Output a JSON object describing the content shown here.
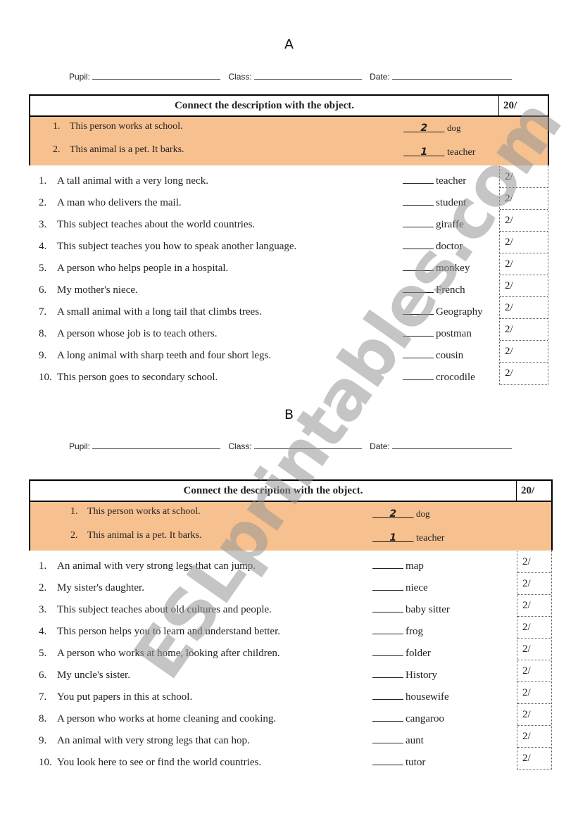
{
  "watermark": "ESLprintables.com",
  "sections": [
    {
      "title": "A",
      "info": {
        "pupil_label": "Pupil:",
        "class_label": "Class:",
        "date_label": "Date:"
      },
      "instruction": "Connect the description with the object.",
      "total_score": "20/",
      "examples": [
        {
          "num": "1.",
          "text": "This person works at school.",
          "answer": "2",
          "option": "dog"
        },
        {
          "num": "2.",
          "text": "This animal is a pet. It barks.",
          "answer": "1",
          "option": "teacher"
        }
      ],
      "items": [
        {
          "num": "1.",
          "text": "A tall animal with a very long neck.",
          "option": "teacher",
          "score": "2/"
        },
        {
          "num": "2.",
          "text": "A man who delivers the mail.",
          "option": "student",
          "score": "2/"
        },
        {
          "num": "3.",
          "text": "This subject teaches about the world countries.",
          "option": "giraffe",
          "score": "2/"
        },
        {
          "num": "4.",
          "text": "This subject teaches you how to speak another language.",
          "option": "doctor",
          "score": "2/"
        },
        {
          "num": "5.",
          "text": "A person who helps people in a hospital.",
          "option": "monkey",
          "score": "2/"
        },
        {
          "num": "6.",
          "text": "My mother's niece.",
          "option": "French",
          "score": "2/"
        },
        {
          "num": "7.",
          "text": "A small animal with a long tail that climbs trees.",
          "option": "Geography",
          "score": "2/"
        },
        {
          "num": "8.",
          "text": "A person whose job is to teach others.",
          "option": "postman",
          "score": "2/"
        },
        {
          "num": "9.",
          "text": "A long animal with sharp teeth and four short legs.",
          "option": "cousin",
          "score": "2/"
        },
        {
          "num": "10.",
          "text": "This person goes to secondary school.",
          "option": "crocodile",
          "score": "2/"
        }
      ]
    },
    {
      "title": "B",
      "info": {
        "pupil_label": "Pupil:",
        "class_label": "Class:",
        "date_label": "Date:"
      },
      "instruction": "Connect the description with the object.",
      "total_score": "20/",
      "examples": [
        {
          "num": "1.",
          "text": "This person works at school.",
          "answer": "2",
          "option": "dog"
        },
        {
          "num": "2.",
          "text": "This animal is a pet. It barks.",
          "answer": "1",
          "option": "teacher"
        }
      ],
      "items": [
        {
          "num": "1.",
          "text": "An animal with very strong legs that can jump.",
          "option": "map",
          "score": "2/"
        },
        {
          "num": "2.",
          "text": "My sister's daughter.",
          "option": "niece",
          "score": "2/"
        },
        {
          "num": "3.",
          "text": "This subject teaches about old cultures and people.",
          "option": "baby sitter",
          "score": "2/"
        },
        {
          "num": "4.",
          "text": "This person helps you to learn and understand better.",
          "option": "frog",
          "score": "2/"
        },
        {
          "num": "5.",
          "text": "A person who works at home, looking after children.",
          "option": "folder",
          "score": "2/"
        },
        {
          "num": "6.",
          "text": "My uncle's sister.",
          "option": "History",
          "score": "2/"
        },
        {
          "num": "7.",
          "text": "You put papers in this at school.",
          "option": "housewife",
          "score": "2/"
        },
        {
          "num": "8.",
          "text": "A person who works at home cleaning and cooking.",
          "option": "cangaroo",
          "score": "2/"
        },
        {
          "num": "9.",
          "text": "An animal with very strong legs that can hop.",
          "option": "aunt",
          "score": "2/"
        },
        {
          "num": "10.",
          "text": "You look here to see or find the world countries.",
          "option": "tutor",
          "score": "2/"
        }
      ]
    }
  ]
}
